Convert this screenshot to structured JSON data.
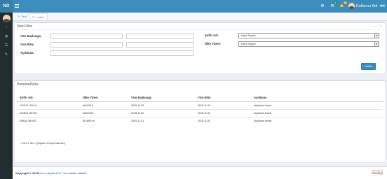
{
  "header": {
    "brand": "NO",
    "user_name": "Kullanıcı Adı",
    "icons": [
      {
        "name": "settings-icon",
        "glyph": "⚙",
        "badge": "",
        "badge_color": ""
      },
      {
        "name": "mail-icon",
        "glyph": "✉",
        "badge": "4",
        "badge_color": "#00a65a"
      },
      {
        "name": "bell-icon",
        "glyph": "🔔",
        "badge": "10",
        "badge_color": "#f39c12"
      },
      {
        "name": "flag-icon",
        "glyph": "⚑",
        "badge": "9",
        "badge_color": "#dd4b39"
      }
    ]
  },
  "sidebar": {
    "icons": [
      "dashboard-icon",
      "globe-icon",
      "list-icon",
      "edit-icon"
    ]
  },
  "tabs": [
    {
      "label": "Yeni",
      "icon": "new-icon",
      "glyph": "✎"
    },
    {
      "label": "Listele",
      "icon": "list-icon",
      "glyph": "☰"
    }
  ],
  "filter": {
    "title": "Vize Filtre",
    "tools": [
      "−",
      "×"
    ],
    "labels": {
      "vize_baslangic": "Vize Başlangıç:",
      "vize_bitis": "Vize Bitiş:",
      "aciklama": "Açıklama:",
      "sofor_adi": "Şoför Adı:",
      "ulke_vizesi": "Ülke Vizesi:"
    },
    "selects": {
      "sofor_adi": "Kayıt Seçiniz",
      "ulke_vizesi": "Kayıt Seçiniz"
    },
    "button": "Listele"
  },
  "table": {
    "title": "Personel/Vize",
    "headers": [
      "Şoför Adı",
      "Ülke Vizesi",
      "Vize Başlangıç",
      "Vize Bitiş",
      "Açıklama"
    ],
    "rows": [
      [
        "YUSUF LEYLA",
        "ANGOLA",
        "2015-11-03",
        "2015-11-04",
        "Açıklama Yusuf"
      ],
      [
        "MURAT BEYAZ",
        "ANDORA",
        "2015-11-02",
        "2015-11-03",
        "Açıklama Murat"
      ],
      [
        "İSMAİL BEYAZ",
        "ALMANYA",
        "2015-11-01",
        "2015-11-02",
        "Açıklama İsmail"
      ]
    ],
    "pager": "« Geri 1 İleri » [Toplam 3 Kayıt Bulundu]"
  },
  "footer": {
    "copyright_prefix": "Copyright © 2016",
    "company": "Neo Lojistik A.Ş.",
    "rights": "Tüm hakları saklıdır.",
    "powered_by": "powered by",
    "powered_logo": "Corday"
  }
}
